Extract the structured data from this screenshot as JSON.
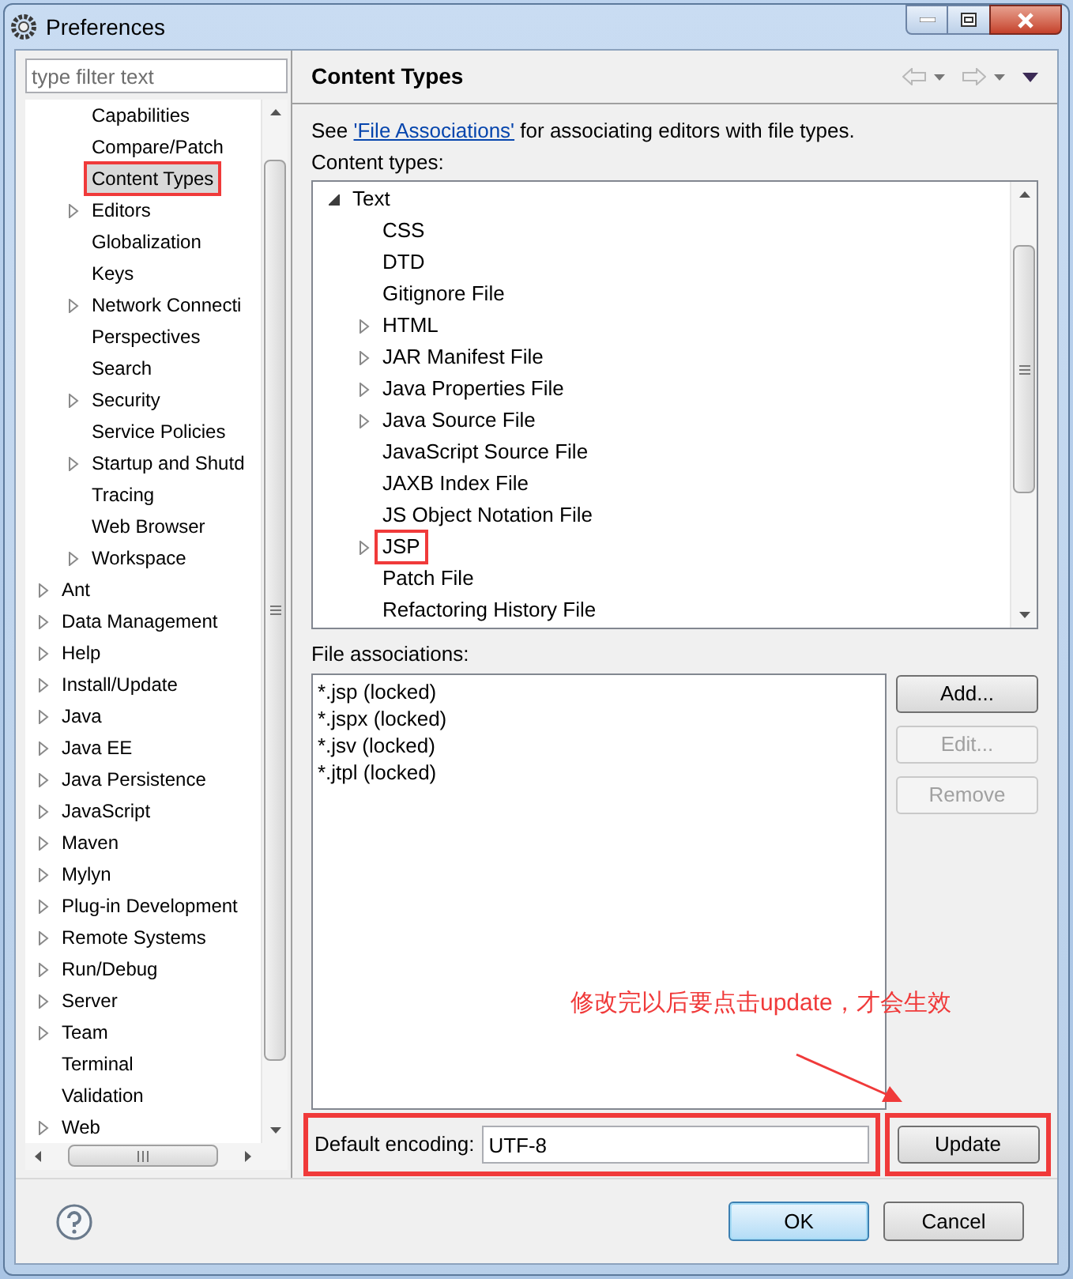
{
  "window": {
    "title": "Preferences"
  },
  "filter": {
    "placeholder": "type filter text"
  },
  "nav_tree": {
    "scrolled_children": [
      {
        "label": "Capabilities",
        "has_children": false,
        "selected": false,
        "annotated": false
      },
      {
        "label": "Compare/Patch",
        "has_children": false,
        "selected": false,
        "annotated": false
      },
      {
        "label": "Content Types",
        "has_children": false,
        "selected": true,
        "annotated": true
      },
      {
        "label": "Editors",
        "has_children": true,
        "expanded": false,
        "selected": false,
        "annotated": false
      },
      {
        "label": "Globalization",
        "has_children": false,
        "selected": false,
        "annotated": false
      },
      {
        "label": "Keys",
        "has_children": false,
        "selected": false,
        "annotated": false
      },
      {
        "label": "Network Connecti",
        "has_children": true,
        "expanded": false,
        "selected": false,
        "annotated": false
      },
      {
        "label": "Perspectives",
        "has_children": false,
        "selected": false,
        "annotated": false
      },
      {
        "label": "Search",
        "has_children": false,
        "selected": false,
        "annotated": false
      },
      {
        "label": "Security",
        "has_children": true,
        "expanded": false,
        "selected": false,
        "annotated": false
      },
      {
        "label": "Service Policies",
        "has_children": false,
        "selected": false,
        "annotated": false
      },
      {
        "label": "Startup and Shutd",
        "has_children": true,
        "expanded": false,
        "selected": false,
        "annotated": false
      },
      {
        "label": "Tracing",
        "has_children": false,
        "selected": false,
        "annotated": false
      },
      {
        "label": "Web Browser",
        "has_children": false,
        "selected": false,
        "annotated": false
      },
      {
        "label": "Workspace",
        "has_children": true,
        "expanded": false,
        "selected": false,
        "annotated": false
      }
    ],
    "items": [
      {
        "label": "Ant",
        "has_children": true,
        "expanded": false,
        "selected": false,
        "annotated": false
      },
      {
        "label": "Data Management",
        "has_children": true,
        "expanded": false,
        "selected": false,
        "annotated": false
      },
      {
        "label": "Help",
        "has_children": true,
        "expanded": false,
        "selected": false,
        "annotated": false
      },
      {
        "label": "Install/Update",
        "has_children": true,
        "expanded": false,
        "selected": false,
        "annotated": false
      },
      {
        "label": "Java",
        "has_children": true,
        "expanded": false,
        "selected": false,
        "annotated": false
      },
      {
        "label": "Java EE",
        "has_children": true,
        "expanded": false,
        "selected": false,
        "annotated": false
      },
      {
        "label": "Java Persistence",
        "has_children": true,
        "expanded": false,
        "selected": false,
        "annotated": false
      },
      {
        "label": "JavaScript",
        "has_children": true,
        "expanded": false,
        "selected": false,
        "annotated": false
      },
      {
        "label": "Maven",
        "has_children": true,
        "expanded": false,
        "selected": false,
        "annotated": false
      },
      {
        "label": "Mylyn",
        "has_children": true,
        "expanded": false,
        "selected": false,
        "annotated": false
      },
      {
        "label": "Plug-in Development",
        "has_children": true,
        "expanded": false,
        "selected": false,
        "annotated": false
      },
      {
        "label": "Remote Systems",
        "has_children": true,
        "expanded": false,
        "selected": false,
        "annotated": false
      },
      {
        "label": "Run/Debug",
        "has_children": true,
        "expanded": false,
        "selected": false,
        "annotated": false
      },
      {
        "label": "Server",
        "has_children": true,
        "expanded": false,
        "selected": false,
        "annotated": false
      },
      {
        "label": "Team",
        "has_children": true,
        "expanded": false,
        "selected": false,
        "annotated": false
      },
      {
        "label": "Terminal",
        "has_children": false,
        "selected": false,
        "annotated": false
      },
      {
        "label": "Validation",
        "has_children": false,
        "selected": false,
        "annotated": false
      },
      {
        "label": "Web",
        "has_children": true,
        "expanded": false,
        "selected": false,
        "annotated": false
      }
    ]
  },
  "page": {
    "title": "Content Types",
    "intro_before": "See ",
    "intro_link": "'File Associations'",
    "intro_after": " for associating editors with file types.",
    "content_types_label": "Content types:",
    "content_types": [
      {
        "label": "Text",
        "has_children": true,
        "expanded": true,
        "selected": false,
        "annotated": false,
        "children": [
          {
            "label": "CSS",
            "has_children": false,
            "selected": false,
            "annotated": false
          },
          {
            "label": "DTD",
            "has_children": false,
            "selected": false,
            "annotated": false
          },
          {
            "label": "Gitignore File",
            "has_children": false,
            "selected": false,
            "annotated": false
          },
          {
            "label": "HTML",
            "has_children": true,
            "expanded": false,
            "selected": false,
            "annotated": false
          },
          {
            "label": "JAR Manifest File",
            "has_children": true,
            "expanded": false,
            "selected": false,
            "annotated": false
          },
          {
            "label": "Java Properties File",
            "has_children": true,
            "expanded": false,
            "selected": false,
            "annotated": false
          },
          {
            "label": "Java Source File",
            "has_children": true,
            "expanded": false,
            "selected": false,
            "annotated": false
          },
          {
            "label": "JavaScript Source File",
            "has_children": false,
            "selected": false,
            "annotated": false
          },
          {
            "label": "JAXB Index File",
            "has_children": false,
            "selected": false,
            "annotated": false
          },
          {
            "label": "JS Object Notation File",
            "has_children": false,
            "selected": false,
            "annotated": false
          },
          {
            "label": "JSP",
            "has_children": true,
            "expanded": false,
            "selected": false,
            "annotated": true
          },
          {
            "label": "Patch File",
            "has_children": false,
            "selected": false,
            "annotated": false
          },
          {
            "label": "Refactoring History File",
            "has_children": false,
            "selected": false,
            "annotated": false
          }
        ]
      }
    ],
    "file_associations_label": "File associations:",
    "file_associations": [
      "*.jsp (locked)",
      "*.jspx (locked)",
      "*.jsv (locked)",
      "*.jtpl (locked)"
    ],
    "buttons": [
      {
        "label": "Add...",
        "disabled": false
      },
      {
        "label": "Edit...",
        "disabled": true
      },
      {
        "label": "Remove",
        "disabled": true
      }
    ],
    "encoding": {
      "label": "Default encoding:",
      "value": "UTF-8",
      "annotated": true
    },
    "update": {
      "label": "Update",
      "annotated": true
    }
  },
  "annotation": {
    "text": "修改完以后要点击update，才会生效"
  },
  "dialog_buttons": [
    {
      "label": "OK",
      "default": true
    },
    {
      "label": "Cancel",
      "default": false
    }
  ]
}
